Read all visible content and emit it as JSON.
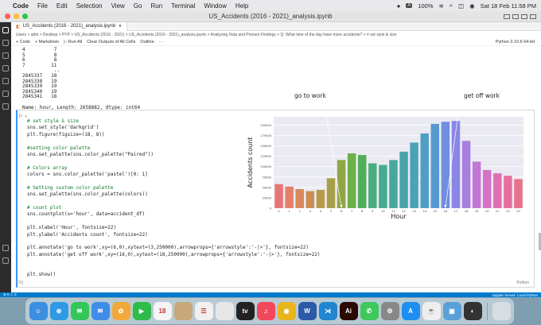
{
  "menubar": {
    "apple": "",
    "app": "Code",
    "items": [
      "File",
      "Edit",
      "Selection",
      "View",
      "Go",
      "Run",
      "Terminal",
      "Window",
      "Help"
    ],
    "battery": "100%",
    "datetime": "Sat 18 Feb  11:58 PM"
  },
  "window": {
    "title": "US_Accidents (2016 - 2021)_analysis.ipynb"
  },
  "tab": {
    "label": "US_Accidents (2016 - 2021)_analysis.ipynb",
    "modified": "●",
    "close": "×"
  },
  "breadcrumb": "Users > abhi > Desktop > PYP > US_Accidents (2016 - 2021) > US_Accidents (2016 - 2021)_analysis.ipynb > Analyzing Data and Present Findings > Q: What time of the day have more accidents? > # set style & size",
  "toolbar": {
    "code": "+ Code",
    "markdown": "+ Markdown",
    "run_all": "▷ Run All",
    "clear": "Clear Outputs of All Cells",
    "outline": "Outline",
    "more": "···",
    "kernel": "Python 3.10.6 64-bit"
  },
  "output": {
    "lines": [
      "4          7",
      "5          8",
      "6          8",
      "7         11",
      "           ..",
      "2845337   18",
      "2845338   19",
      "2845339   19",
      "2845340   19",
      "2845341   18"
    ],
    "summary": "Name: hour, Length: 2658882, dtype: int64"
  },
  "annotations": {
    "go_to_work": "go to work",
    "get_off_work": "get off work"
  },
  "cell": {
    "code_lines": [
      {
        "t": "# set style & size",
        "c": "c"
      },
      {
        "t": "sns.set_style('darkgrid')",
        "c": ""
      },
      {
        "t": "plt.figure(figsize=(18, 8))",
        "c": ""
      },
      {
        "t": "",
        "c": ""
      },
      {
        "t": "#setting color palette",
        "c": "c"
      },
      {
        "t": "sns.set_palette(sns.color_palette(\"Paired\"))",
        "c": ""
      },
      {
        "t": "",
        "c": ""
      },
      {
        "t": "# Colors array",
        "c": "c"
      },
      {
        "t": "colors = sns.color_palette('pastel')[0: 1]",
        "c": ""
      },
      {
        "t": "",
        "c": ""
      },
      {
        "t": "# Setting custom color palette",
        "c": "c"
      },
      {
        "t": "sns.set_palette(sns.color_palette(colors))",
        "c": ""
      },
      {
        "t": "",
        "c": ""
      },
      {
        "t": "# count plot",
        "c": "c"
      },
      {
        "t": "sns.countplot(x='hour', data=accident_df)",
        "c": ""
      },
      {
        "t": "",
        "c": ""
      },
      {
        "t": "plt.xlabel('Hour', fontsize=22)",
        "c": ""
      },
      {
        "t": "plt.ylabel('Accidents count', fontsize=22)",
        "c": ""
      },
      {
        "t": "",
        "c": ""
      },
      {
        "t": "plt.annotate('go to work',xy=(6,0),xytext=(3,250000),arrowprops={'arrowstyle':'-|>'}, fontsize=22)",
        "c": ""
      },
      {
        "t": "plt.annotate('get off work',xy=(16,0),xytext=(18,250000),arrowprops={'arrowstyle':'-|>'}, fontsize=22)",
        "c": ""
      },
      {
        "t": "",
        "c": ""
      },
      {
        "t": "",
        "c": ""
      },
      {
        "t": "plt.show()",
        "c": ""
      }
    ],
    "number": "[25]",
    "language": "Python"
  },
  "chart_data": {
    "type": "bar",
    "categories": [
      "0",
      "1",
      "2",
      "3",
      "4",
      "5",
      "6",
      "7",
      "8",
      "9",
      "10",
      "11",
      "12",
      "13",
      "14",
      "15",
      "16",
      "17",
      "18",
      "19",
      "20",
      "21",
      "22",
      "23"
    ],
    "values": [
      58000,
      52000,
      46000,
      41000,
      44000,
      72000,
      116000,
      132000,
      128000,
      108000,
      104000,
      116000,
      136000,
      158000,
      180000,
      203000,
      208000,
      210000,
      162000,
      112000,
      92000,
      84000,
      78000,
      70000
    ],
    "xlabel": "Hour",
    "ylabel": "Accidents count",
    "ylim": [
      0,
      220000
    ],
    "yticks": [
      0,
      25000,
      50000,
      75000,
      100000,
      125000,
      150000,
      175000,
      200000
    ],
    "annotations": [
      {
        "text": "go to work",
        "x": 6,
        "xytext": [
          3,
          250000
        ]
      },
      {
        "text": "get off work",
        "x": 16,
        "xytext": [
          18,
          250000
        ]
      }
    ],
    "grid": true
  },
  "colors": {
    "bars": [
      "#e8757a",
      "#e58066",
      "#d9885a",
      "#c98e50",
      "#b89a4c",
      "#a7a04a",
      "#8fa645",
      "#6db04a",
      "#52ad58",
      "#4aad7f",
      "#46ab91",
      "#47a79e",
      "#48a5a9",
      "#4aa2b5",
      "#4f9fc3",
      "#5699d2",
      "#6f8ee0",
      "#8a86e6",
      "#a87ee0",
      "#c276d6",
      "#d771c5",
      "#e070b2",
      "#e66f9e",
      "#e8728a"
    ],
    "accent": "#007acc"
  },
  "statusbar": {
    "left": "⊗ 0 ⚠ 0",
    "right": "Jupyter Server: Local    Python"
  },
  "dock": {
    "apps": [
      {
        "name": "finder",
        "label": "☺",
        "color": "#3c8ee0"
      },
      {
        "name": "safari",
        "label": "⊕",
        "color": "#2e9ae6"
      },
      {
        "name": "messages",
        "label": "✉",
        "color": "#35c659"
      },
      {
        "name": "mail",
        "label": "✉",
        "color": "#3f8de8"
      },
      {
        "name": "photos",
        "label": "✿",
        "color": "#f2a93b"
      },
      {
        "name": "facetime",
        "label": "▶",
        "color": "#2dbb4a"
      },
      {
        "name": "calendar",
        "label": "18",
        "color": "#f4f4f4"
      },
      {
        "name": "notes",
        "label": "",
        "color": "#c8a77b"
      },
      {
        "name": "reminders",
        "label": "☰",
        "color": "#f0f0f0"
      },
      {
        "name": "stickies",
        "label": "",
        "color": "#e7e7e7"
      },
      {
        "name": "tv",
        "label": "tv",
        "color": "#222"
      },
      {
        "name": "music",
        "label": "♫",
        "color": "#f2475c"
      },
      {
        "name": "chrome",
        "label": "◉",
        "color": "#e8b51f"
      },
      {
        "name": "word",
        "label": "W",
        "color": "#2b5aa7"
      },
      {
        "name": "vscode",
        "label": "⋊",
        "color": "#2185d0"
      },
      {
        "name": "illustrator",
        "label": "Ai",
        "color": "#2b0a03"
      },
      {
        "name": "whatsapp",
        "label": "✆",
        "color": "#3ec95b"
      },
      {
        "name": "settings",
        "label": "⚙",
        "color": "#888"
      },
      {
        "name": "appstore",
        "label": "A",
        "color": "#1f8ef1"
      },
      {
        "name": "java",
        "label": "☕",
        "color": "#eee"
      },
      {
        "name": "preview",
        "label": "▣",
        "color": "#5aa0d8"
      },
      {
        "name": "screenrecorder",
        "label": "◐",
        "color": "#333"
      },
      {
        "name": "trash",
        "label": "",
        "color": "#d8dde2"
      }
    ]
  }
}
